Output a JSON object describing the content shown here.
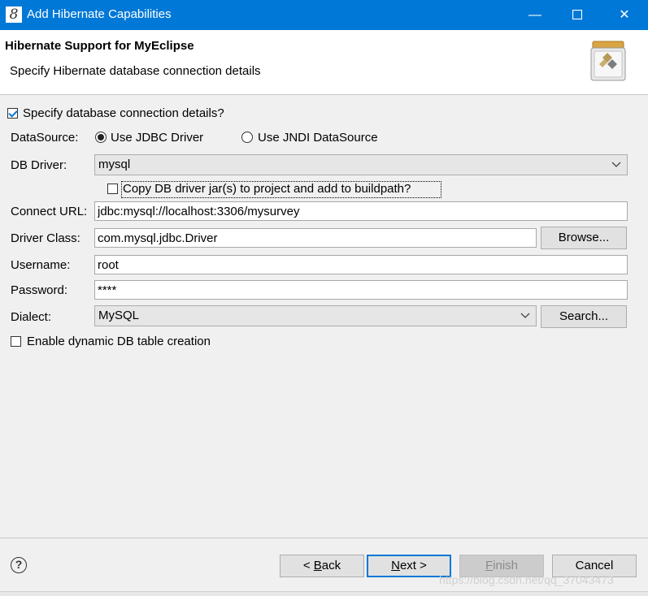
{
  "window": {
    "title": "Add Hibernate Capabilities",
    "app_icon_glyph": "8",
    "minimize_glyph": "—",
    "maximize_glyph": "☐",
    "close_glyph": "✕",
    "titlebar_color": "#0078d7"
  },
  "header": {
    "title": "Hibernate Support for MyEclipse",
    "subtitle": "Specify Hibernate database connection details",
    "banner_icon": "hibernate-jar-icon"
  },
  "form": {
    "specify_checkbox": {
      "label": "Specify database connection details?",
      "checked": true
    },
    "datasource": {
      "label": "DataSource:",
      "options": [
        "Use JDBC Driver",
        "Use JNDI DataSource"
      ],
      "selected": "Use JDBC Driver"
    },
    "db_driver": {
      "label": "DB Driver:",
      "value": "mysql"
    },
    "copy_jar_checkbox": {
      "label": "Copy DB driver jar(s) to project and add to buildpath?",
      "checked": false
    },
    "connect_url": {
      "label": "Connect URL:",
      "value": "jdbc:mysql://localhost:3306/mysurvey"
    },
    "driver_class": {
      "label": "Driver Class:",
      "value": "com.mysql.jdbc.Driver",
      "button": "Browse..."
    },
    "username": {
      "label": "Username:",
      "value": "root"
    },
    "password": {
      "label": "Password:",
      "value": "****"
    },
    "dialect": {
      "label": "Dialect:",
      "value": "MySQL",
      "button": "Search..."
    },
    "dynamic_checkbox": {
      "label": "Enable dynamic DB table creation",
      "checked": false
    }
  },
  "footer": {
    "help_glyph": "?",
    "back": {
      "prefix": "< ",
      "mnemonic": "B",
      "rest": "ack"
    },
    "next": {
      "mnemonic": "N",
      "rest": "ext >"
    },
    "finish": {
      "mnemonic": "F",
      "rest": "inish"
    },
    "cancel": "Cancel",
    "watermark": "https://blog.csdn.net/qq_37043473"
  }
}
